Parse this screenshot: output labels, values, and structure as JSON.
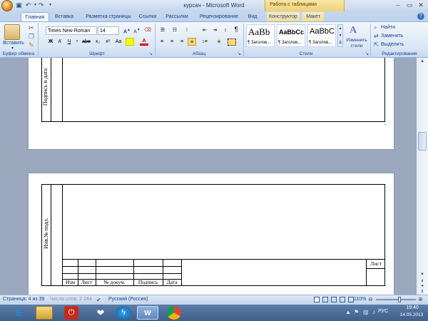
{
  "window": {
    "title": "курсач - Microsoft Word",
    "context_band": "Работа с таблицами"
  },
  "tabs": [
    "Главная",
    "Вставка",
    "Разметка страницы",
    "Ссылки",
    "Рассылки",
    "Рецензирование",
    "Вид",
    "Конструктор",
    "Макет"
  ],
  "ribbon": {
    "clipboard": {
      "paste_label": "Вставить",
      "group": "Буфер обмена"
    },
    "font": {
      "name": "Times New Roman",
      "size": "14",
      "group": "Шрифт",
      "bold": "Ж",
      "italic": "К",
      "underline": "Ч"
    },
    "paragraph": {
      "group": "Абзац"
    },
    "styles": {
      "group": "Стили",
      "tiles": [
        {
          "sample": "AaBb",
          "caption": "¶ Заголов..."
        },
        {
          "sample": "AaBbCc",
          "caption": "¶ Заголов..."
        },
        {
          "sample": "AaBbC",
          "caption": "¶ Заголов..."
        }
      ],
      "change_styles": "Изменить стили"
    },
    "editing": {
      "group": "Редактирование",
      "find": "Найти",
      "replace": "Заменить",
      "select": "Выделить"
    }
  },
  "document": {
    "page1_side_label": "Подпись и дата",
    "page2_side_label": "Инв.№ подл.",
    "stamp": {
      "headers": [
        "Изм",
        "Лист",
        "№ докум.",
        "Подпись",
        "Дата"
      ],
      "sheet_label": "Лист"
    }
  },
  "status": {
    "page": "Страница: 4 из 39",
    "words": "Число слов: 2 244",
    "language": "Русский (Россия)",
    "zoom": "110%"
  },
  "tray": {
    "lang": "РУС",
    "time": "19:40",
    "date": "14.05.2013"
  }
}
